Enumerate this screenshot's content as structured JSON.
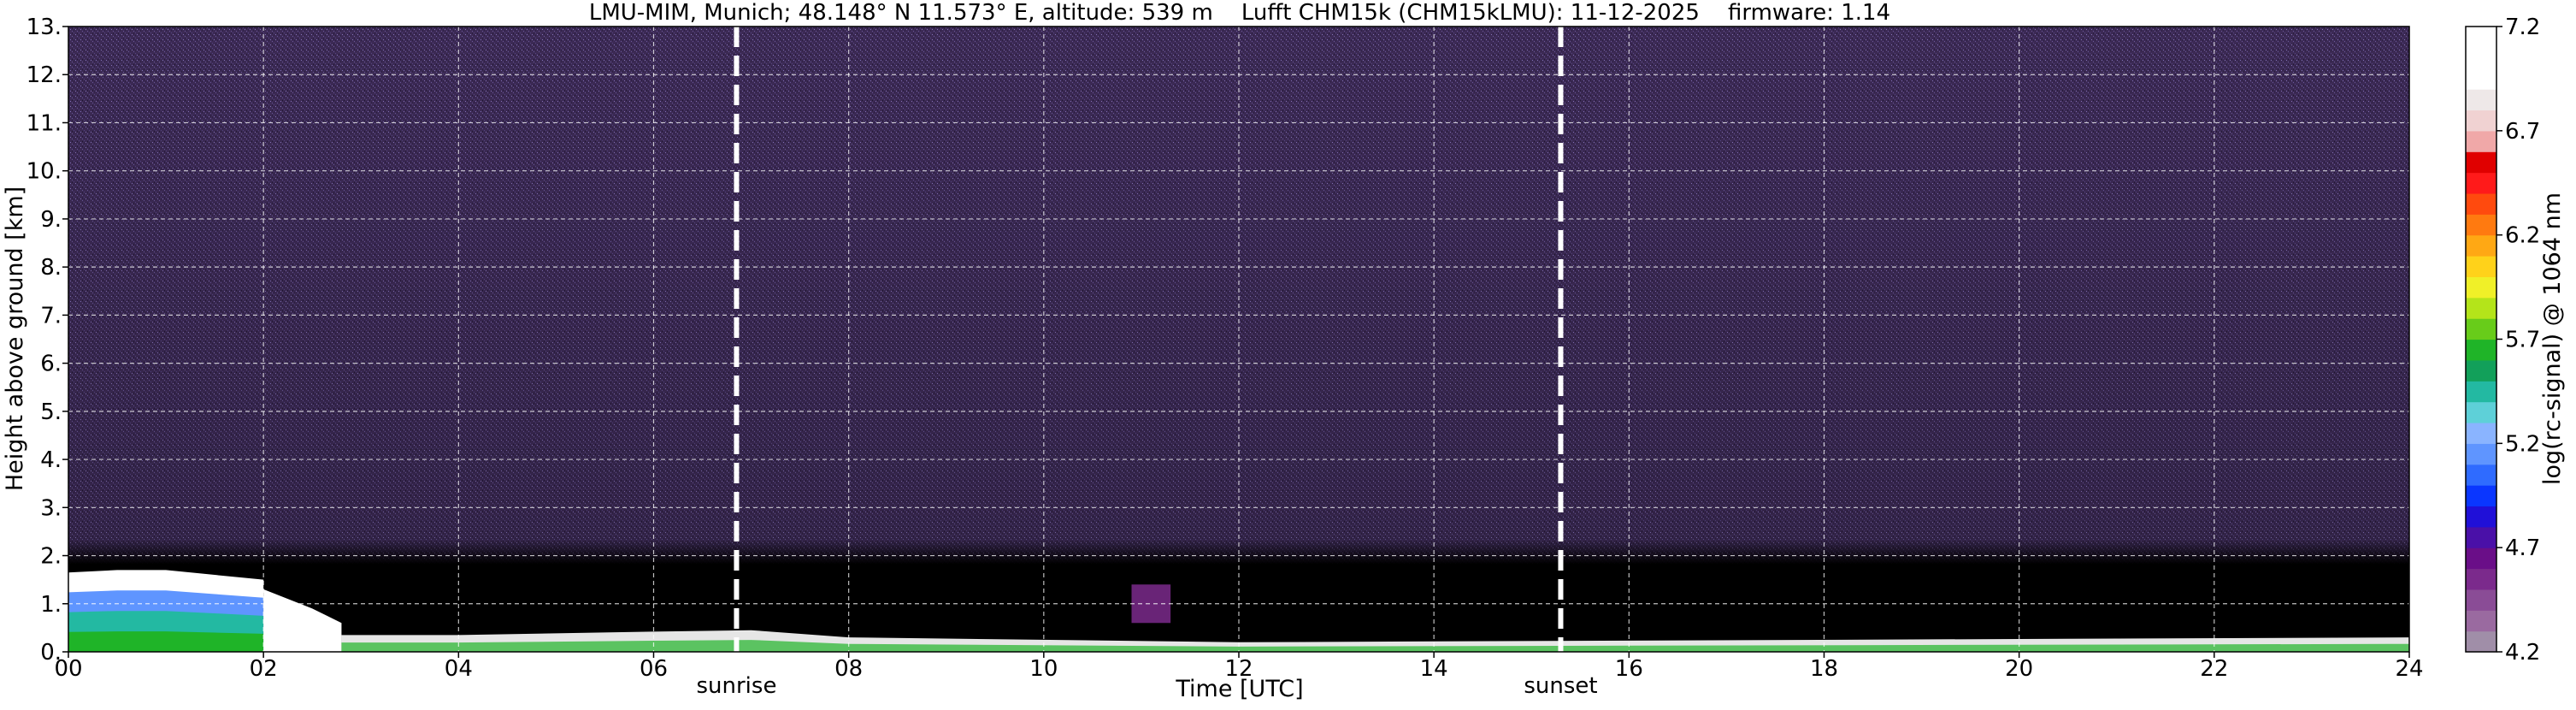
{
  "chart_data": {
    "type": "heatmap",
    "title": "LMU-MIM, Munich; 48.148° N 11.573° E, altitude: 539 m    Lufft CHM15k (CHM15kLMU): 11-12-2025    firmware: 1.14",
    "xlabel": "Time [UTC]",
    "ylabel": "Height above ground [km]",
    "xlim": [
      0,
      24
    ],
    "ylim": [
      0,
      13
    ],
    "xticks": [
      0,
      2,
      4,
      6,
      8,
      10,
      12,
      14,
      16,
      18,
      20,
      22,
      24
    ],
    "xtick_labels": [
      "00",
      "02",
      "04",
      "06",
      "08",
      "10",
      "12",
      "14",
      "16",
      "18",
      "20",
      "22",
      "24"
    ],
    "yticks": [
      0,
      1,
      2,
      3,
      4,
      5,
      6,
      7,
      8,
      9,
      10,
      11,
      12,
      13
    ],
    "ytick_labels": [
      "0.",
      "1.",
      "2.",
      "3.",
      "4.",
      "5.",
      "6.",
      "7.",
      "8.",
      "9.",
      "10.",
      "11.",
      "12.",
      "13."
    ],
    "grid": true,
    "annotations": [
      {
        "label": "sunrise",
        "x": 6.85
      },
      {
        "label": "sunset",
        "x": 15.3
      }
    ],
    "colorbar": {
      "label": "log(rc-signal) @ 1064 nm",
      "range": [
        4.2,
        7.2
      ],
      "ticks": [
        4.2,
        4.7,
        5.2,
        5.7,
        6.2,
        6.7,
        7.2
      ],
      "tick_labels": [
        "4.2",
        "4.7",
        "5.2",
        "5.7",
        "6.2",
        "6.7",
        "7.2"
      ],
      "colors": [
        "#a08ea8",
        "#9a6aa0",
        "#8a4c96",
        "#7b2a8c",
        "#6a0e88",
        "#4a10a8",
        "#2010d8",
        "#0a36ff",
        "#2f6bff",
        "#5f95ff",
        "#8ab4ff",
        "#5ed0d8",
        "#23b9a2",
        "#12a05a",
        "#1fb428",
        "#68cc1a",
        "#b4e41a",
        "#f0f028",
        "#ffd21a",
        "#ffa814",
        "#ff7a10",
        "#ff4a0e",
        "#ff1a1a",
        "#e00000",
        "#f0a8a8",
        "#f0d2d2",
        "#eee8e8",
        "#ffffff",
        "#ffffff",
        "#ffffff"
      ]
    },
    "noise_color": "#3c2a55",
    "features": [
      {
        "kind": "boundary_layer",
        "x": [
          0.0,
          0.5,
          1.0,
          1.5,
          2.0
        ],
        "top": [
          1.65,
          1.7,
          1.7,
          1.6,
          1.5
        ],
        "colors": [
          "#ffffff",
          "#5f95ff",
          "#23b9a2",
          "#1fb428"
        ]
      },
      {
        "kind": "boundary_layer",
        "x": [
          2.0,
          2.5,
          2.8
        ],
        "top": [
          1.3,
          0.9,
          0.6
        ],
        "colors": [
          "#ffffff"
        ]
      },
      {
        "kind": "surface_layer",
        "x": [
          2.8,
          4,
          6,
          7,
          8,
          12,
          24
        ],
        "top": [
          0.35,
          0.35,
          0.42,
          0.45,
          0.3,
          0.2,
          0.3
        ]
      },
      {
        "kind": "patch",
        "x": [
          10.9,
          11.3
        ],
        "y": [
          0.6,
          1.4
        ],
        "color": "#7b2a8c"
      }
    ]
  }
}
